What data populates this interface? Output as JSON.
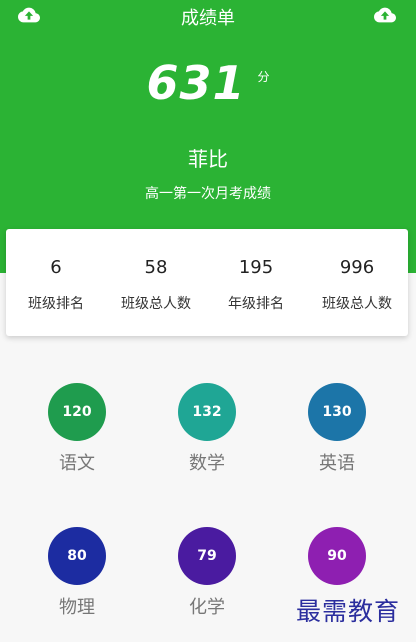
{
  "header": {
    "title": "成绩单",
    "score": "631",
    "score_unit": "分",
    "student_name": "菲比",
    "exam_name": "高一第一次月考成绩",
    "background_color": "#2bb334",
    "left_icon": "cloud-upload-icon",
    "right_icon": "cloud-upload-icon"
  },
  "stats": [
    {
      "value": "6",
      "label": "班级排名"
    },
    {
      "value": "58",
      "label": "班级总人数"
    },
    {
      "value": "195",
      "label": "年级排名"
    },
    {
      "value": "996",
      "label": "班级总人数"
    }
  ],
  "subjects": [
    {
      "name": "语文",
      "score": "120",
      "color": "#1f9c4e"
    },
    {
      "name": "数学",
      "score": "132",
      "color": "#1fa695"
    },
    {
      "name": "英语",
      "score": "130",
      "color": "#1c75a8"
    },
    {
      "name": "物理",
      "score": "80",
      "color": "#1c2ca1"
    },
    {
      "name": "化学",
      "score": "79",
      "color": "#4a1ba0"
    },
    {
      "name": "",
      "score": "90",
      "color": "#8e1fb1"
    }
  ],
  "watermark": "最需教育"
}
